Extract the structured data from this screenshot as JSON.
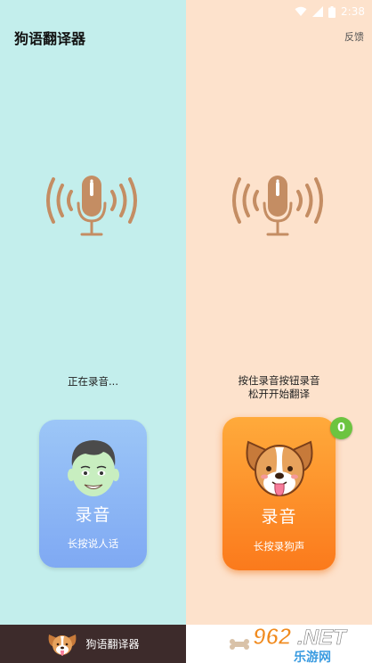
{
  "status_bar": {
    "time": "2:38"
  },
  "header": {
    "title": "狗语翻译器",
    "feedback_label": "反馈"
  },
  "left_panel": {
    "hint_line1": "正在录音...",
    "card": {
      "title": "录音",
      "subtitle": "长按说人话"
    }
  },
  "right_panel": {
    "hint_line1": "按住录音按钮录音",
    "hint_line2": "松开开始翻译",
    "card": {
      "title": "录音",
      "subtitle": "长按录狗声"
    },
    "badge_count": "0"
  },
  "bottom_nav": {
    "tabs": [
      {
        "label": "狗语翻译器",
        "icon": "dog-face-icon",
        "active": true
      },
      {
        "label": "",
        "icon": "bone-icon",
        "active": false
      }
    ]
  },
  "watermark": {
    "text": "乐游网"
  },
  "colors": {
    "left_bg": "#c3eeec",
    "right_bg": "#fde2cc",
    "mic_color": "#c48d63",
    "human_card": "#8ab4f5",
    "dog_card": "#fd8a25",
    "badge": "#6cc440",
    "nav_active": "#3d2b2b"
  }
}
